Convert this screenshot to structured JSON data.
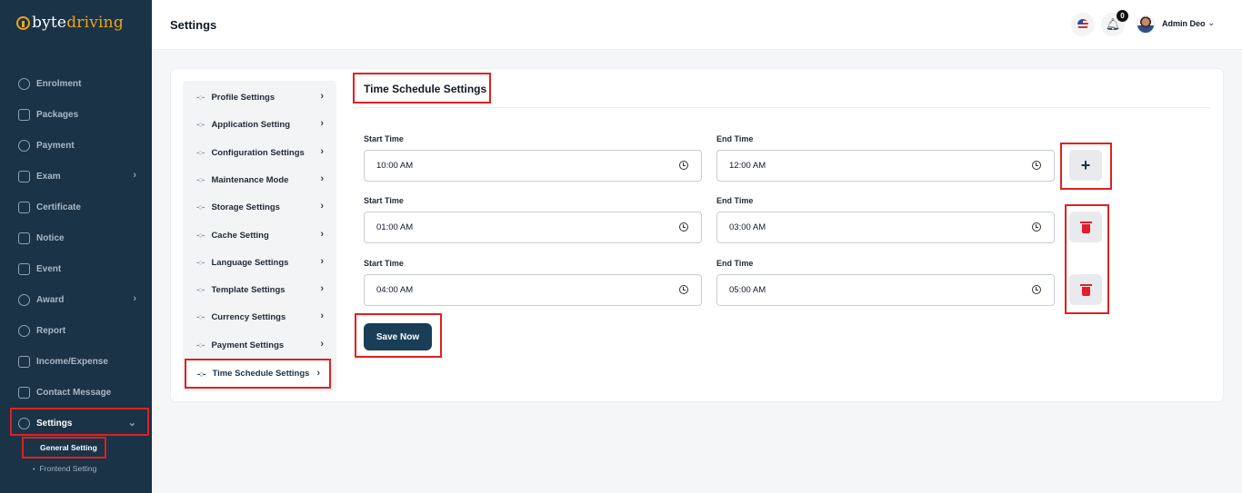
{
  "brand": {
    "part1": "byte",
    "part2": "driving"
  },
  "sidebar": {
    "items": [
      {
        "label": "Enrolment",
        "icon": "enrolment-icon"
      },
      {
        "label": "Packages",
        "icon": "packages-icon"
      },
      {
        "label": "Payment",
        "icon": "payment-icon"
      },
      {
        "label": "Exam",
        "icon": "exam-icon"
      },
      {
        "label": "Certificate",
        "icon": "certificate-icon"
      },
      {
        "label": "Notice",
        "icon": "notice-icon"
      },
      {
        "label": "Event",
        "icon": "event-icon"
      },
      {
        "label": "Award",
        "icon": "award-icon"
      },
      {
        "label": "Report",
        "icon": "report-icon"
      },
      {
        "label": "Income/Expense",
        "icon": "income-expense-icon"
      },
      {
        "label": "Contact Message",
        "icon": "contact-message-icon"
      },
      {
        "label": "Settings",
        "icon": "settings-icon"
      }
    ],
    "sub_items": [
      "General Setting",
      "Frontend Setting"
    ]
  },
  "header": {
    "title": "Settings",
    "notification_count": "0",
    "user_name": "Admin Deo"
  },
  "settings_menu": [
    "Profile Settings",
    "Application Setting",
    "Configuration Settings",
    "Maintenance Mode",
    "Storage Settings",
    "Cache Setting",
    "Language Settings",
    "Template Settings",
    "Currency Settings",
    "Payment Settings",
    "Time Schedule Settings"
  ],
  "section": {
    "title": "Time Schedule Settings",
    "start_label": "Start Time",
    "end_label": "End Time",
    "rows": [
      {
        "start": "10:00 AM",
        "end": "12:00 AM"
      },
      {
        "start": "01:00 AM",
        "end": "03:00 AM"
      },
      {
        "start": "04:00 AM",
        "end": "05:00 AM"
      }
    ],
    "add_symbol": "+",
    "save_label": "Save Now"
  },
  "colors": {
    "sidebar": "#1a3347",
    "accent": "#f0a21a",
    "highlight": "#e02020",
    "delete": "#e11d2e"
  }
}
